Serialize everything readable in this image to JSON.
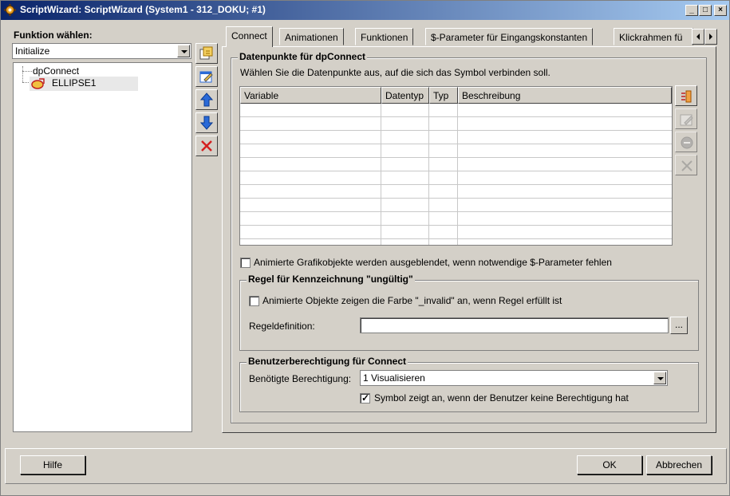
{
  "window": {
    "title": "ScriptWizard: ScriptWizard (System1 - 312_DOKU; #1)",
    "controls": {
      "minimize": "_",
      "maximize": "□",
      "close": "×"
    }
  },
  "left": {
    "label": "Funktion wählen:",
    "function_select": {
      "value": "Initialize"
    },
    "tree": [
      {
        "label": "dpConnect",
        "icon": "none"
      },
      {
        "label": "ELLIPSE1",
        "icon": "ellipse-shape-icon"
      }
    ],
    "tools": [
      "add-script-icon",
      "edit-icon",
      "arrow-up-icon",
      "arrow-down-icon",
      "delete-icon"
    ]
  },
  "tabs": [
    {
      "label": "Connect",
      "active": true
    },
    {
      "label": "Animationen"
    },
    {
      "label": "Funktionen"
    },
    {
      "label": "$-Parameter für Eingangskonstanten"
    },
    {
      "label": "Klickrahmen fü"
    }
  ],
  "connect": {
    "datapoints": {
      "legend": "Datenpunkte für dpConnect",
      "description": "Wählen Sie die Datenpunkte aus, auf die sich das Symbol verbinden soll.",
      "columns": [
        "Variable",
        "Datentyp",
        "Typ",
        "Beschreibung"
      ],
      "row_count": 10,
      "side_buttons": [
        "add-datapoint-icon",
        "edit-icon",
        "remove-icon",
        "delete-icon"
      ]
    },
    "hide_animated": {
      "checked": false,
      "label": "Animierte Grafikobjekte werden ausgeblendet, wenn notwendige $-Parameter fehlen"
    },
    "invalid_rule": {
      "legend": "Regel für Kennzeichnung \"ungültig\"",
      "checkbox_checked": false,
      "checkbox_label": "Animierte Objekte zeigen die Farbe \"_invalid\" an, wenn Regel erfüllt ist",
      "definition_label": "Regeldefinition:",
      "definition_value": "",
      "browse_label": "..."
    },
    "permission": {
      "legend": "Benutzerberechtigung für Connect",
      "required_label": "Benötigte Berechtigung:",
      "required_value": "1 Visualisieren",
      "symbol_checked": true,
      "symbol_label": "Symbol zeigt an, wenn der Benutzer keine Berechtigung hat"
    }
  },
  "footer": {
    "help": "Hilfe",
    "ok": "OK",
    "cancel": "Abbrechen"
  },
  "colors": {
    "title_start": "#0a246a",
    "title_end": "#a6caf0",
    "face": "#d4d0c8",
    "accent_blue": "#2a6ad8",
    "delete_red": "#d42020"
  }
}
